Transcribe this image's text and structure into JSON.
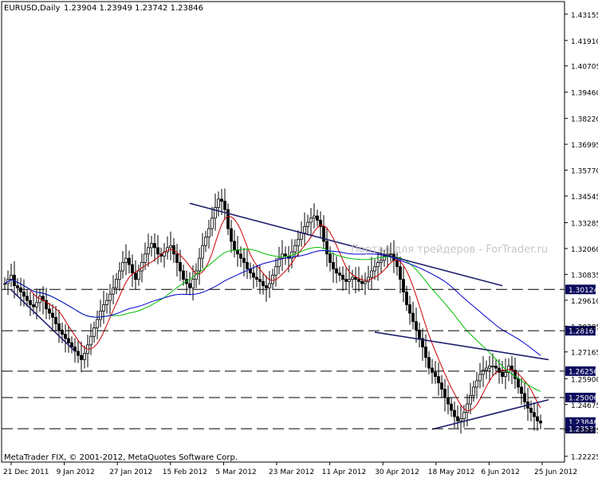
{
  "header": {
    "symbol_timeframe": "EURUSD,Daily",
    "ohlc": "1.23904 1.23949 1.23742 1.23846"
  },
  "footer": {
    "copyright": "MetaTrader FIX, © 2001-2012, MetaQuotes Software Corp."
  },
  "watermark": "Портал для трейдеров - ForTrader.ru",
  "colors": {
    "background": "#ffffff",
    "grid": "#000000",
    "ma_fast": "#cc0000",
    "ma_mid": "#00c000",
    "ma_slow": "#0000cc",
    "trendline": "#1f1f6e",
    "candle": "#000000",
    "level_box": "#0b0b5e"
  },
  "chart_data": {
    "type": "candlestick",
    "symbol": "EURUSD",
    "timeframe": "Daily",
    "y_ticks": [
      "1.43155",
      "1.41910",
      "1.40705",
      "1.39460",
      "1.38220",
      "1.36995",
      "1.35770",
      "1.34545",
      "1.33285",
      "1.32060",
      "1.30835",
      "1.29610",
      "1.28385",
      "1.27165",
      "1.25900",
      "1.24675",
      "1.23485",
      "1.22225"
    ],
    "x_ticks": [
      "21 Dec 2011",
      "9 Jan 2012",
      "27 Jan 2012",
      "15 Feb 2012",
      "5 Mar 2012",
      "23 Mar 2012",
      "11 Apr 2012",
      "30 Apr 2012",
      "18 May 2012",
      "6 Jun 2012",
      "25 Jun 2012"
    ],
    "ylim": [
      1.2195,
      1.4375
    ],
    "highlighted_levels": [
      {
        "label": "1.30124",
        "value": 1.30124,
        "style": "dashed"
      },
      {
        "label": "1.28167",
        "value": 1.28167,
        "style": "dashed"
      },
      {
        "label": "1.26256",
        "value": 1.26256,
        "style": "dashed"
      },
      {
        "label": "1.25006",
        "value": 1.25006,
        "style": "dashed"
      },
      {
        "label": "1.23846",
        "value": 1.23846,
        "style": "current"
      },
      {
        "label": "1.23531",
        "value": 1.23531,
        "style": "dashed"
      }
    ],
    "close_series": [
      1.304,
      1.306,
      1.308,
      1.303,
      1.302,
      1.3,
      1.298,
      1.296,
      1.294,
      1.293,
      1.295,
      1.298,
      1.296,
      1.292,
      1.29,
      1.288,
      1.285,
      1.282,
      1.28,
      1.278,
      1.276,
      1.274,
      1.272,
      1.27,
      1.268,
      1.271,
      1.275,
      1.279,
      1.283,
      1.287,
      1.291,
      1.294,
      1.296,
      1.299,
      1.302,
      1.306,
      1.31,
      1.314,
      1.316,
      1.313,
      1.309,
      1.306,
      1.31,
      1.314,
      1.318,
      1.321,
      1.323,
      1.321,
      1.318,
      1.317,
      1.319,
      1.321,
      1.322,
      1.318,
      1.314,
      1.31,
      1.306,
      1.304,
      1.302,
      1.306,
      1.31,
      1.316,
      1.322,
      1.326,
      1.33,
      1.335,
      1.34,
      1.344,
      1.343,
      1.339,
      1.33,
      1.324,
      1.32,
      1.318,
      1.316,
      1.314,
      1.311,
      1.309,
      1.307,
      1.306,
      1.305,
      1.303,
      1.302,
      1.304,
      1.308,
      1.312,
      1.316,
      1.318,
      1.317,
      1.316,
      1.319,
      1.322,
      1.325,
      1.328,
      1.331,
      1.333,
      1.335,
      1.336,
      1.334,
      1.331,
      1.324,
      1.318,
      1.314,
      1.311,
      1.309,
      1.308,
      1.306,
      1.305,
      1.306,
      1.307,
      1.306,
      1.305,
      1.304,
      1.305,
      1.307,
      1.31,
      1.312,
      1.314,
      1.315,
      1.317,
      1.318,
      1.318,
      1.315,
      1.312,
      1.306,
      1.3,
      1.294,
      1.29,
      1.286,
      1.282,
      1.278,
      1.274,
      1.269,
      1.264,
      1.262,
      1.26,
      1.257,
      1.254,
      1.25,
      1.247,
      1.244,
      1.241,
      1.239,
      1.24,
      1.243,
      1.247,
      1.251,
      1.255,
      1.258,
      1.261,
      1.263,
      1.264,
      1.265,
      1.265,
      1.264,
      1.262,
      1.26,
      1.262,
      1.265,
      1.263,
      1.259,
      1.255,
      1.252,
      1.248,
      1.245,
      1.243,
      1.241,
      1.239,
      1.238
    ]
  }
}
